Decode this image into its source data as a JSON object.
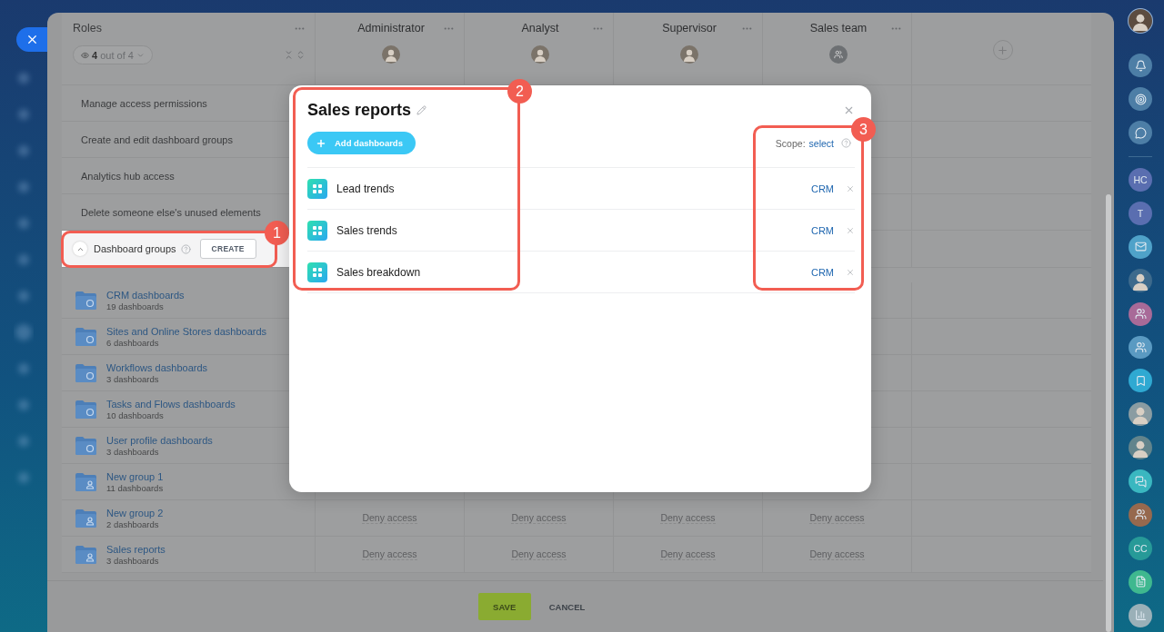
{
  "roles_panel": {
    "title": "Roles",
    "filter": {
      "count": "4",
      "total": "out of 4"
    }
  },
  "roles": [
    {
      "name": "Administrator",
      "kind": "avatar"
    },
    {
      "name": "Analyst",
      "kind": "avatar"
    },
    {
      "name": "Supervisor",
      "kind": "avatar"
    },
    {
      "name": "Sales team",
      "kind": "group"
    }
  ],
  "permissions": [
    "Manage access permissions",
    "Create and edit dashboard groups",
    "Analytics hub access",
    "Delete someone else's unused elements"
  ],
  "dashboard_groups": {
    "label": "Dashboard groups",
    "expanded": true,
    "create_button": "CREATE",
    "callout": "1"
  },
  "groups": [
    {
      "name": "CRM dashboards",
      "count": "19 dashboards",
      "kind": "system"
    },
    {
      "name": "Sites and Online Stores dashboards",
      "count": "6 dashboards",
      "kind": "system"
    },
    {
      "name": "Workflows dashboards",
      "count": "3 dashboards",
      "kind": "system"
    },
    {
      "name": "Tasks and Flows dashboards",
      "count": "10 dashboards",
      "kind": "system"
    },
    {
      "name": "User profile dashboards",
      "count": "3 dashboards",
      "kind": "system"
    },
    {
      "name": "New group 1",
      "count": "11 dashboards",
      "kind": "custom"
    },
    {
      "name": "New group 2",
      "count": "2 dashboards",
      "kind": "custom",
      "access": [
        "Deny access",
        "Deny access",
        "Deny access",
        "Deny access"
      ]
    },
    {
      "name": "Sales reports",
      "count": "3 dashboards",
      "kind": "custom",
      "access": [
        "Deny access",
        "Deny access",
        "Deny access",
        "Deny access"
      ]
    }
  ],
  "modal": {
    "title": "Sales reports",
    "add_button": "Add dashboards",
    "scope_label": "Scope:",
    "scope_link": "select",
    "title_callout": "2",
    "scope_callout": "3",
    "dashboards": [
      {
        "name": "Lead trends",
        "scope": "CRM"
      },
      {
        "name": "Sales trends",
        "scope": "CRM"
      },
      {
        "name": "Sales breakdown",
        "scope": "CRM"
      }
    ]
  },
  "footer": {
    "save": "SAVE",
    "cancel": "CANCEL"
  },
  "right_bar": [
    {
      "kind": "bell",
      "color": "#4d7ea6"
    },
    {
      "kind": "target",
      "color": "#4d7ea6"
    },
    {
      "kind": "chat",
      "color": "#4d7ea6"
    },
    {
      "kind": "initials",
      "text": "HC",
      "color": "#5a6eb0"
    },
    {
      "kind": "initials",
      "text": "T",
      "color": "#5a6eb0"
    },
    {
      "kind": "mail",
      "color": "#4fa2c9"
    },
    {
      "kind": "avatar",
      "color": "#3d6a8c"
    },
    {
      "kind": "group",
      "color": "#a86a98"
    },
    {
      "kind": "group",
      "color": "#5a9ac2"
    },
    {
      "kind": "bookmark",
      "color": "#2fa9d2"
    },
    {
      "kind": "avatar",
      "color": "#8a9ca2"
    },
    {
      "kind": "avatar",
      "color": "#62848c"
    },
    {
      "kind": "messages",
      "color": "#3ab7c0"
    },
    {
      "kind": "group",
      "color": "#96694e"
    },
    {
      "kind": "initials",
      "text": "CC",
      "color": "#279a98"
    },
    {
      "kind": "document",
      "color": "#3fb88f"
    },
    {
      "kind": "chart",
      "color": "#9ab0b8"
    }
  ]
}
